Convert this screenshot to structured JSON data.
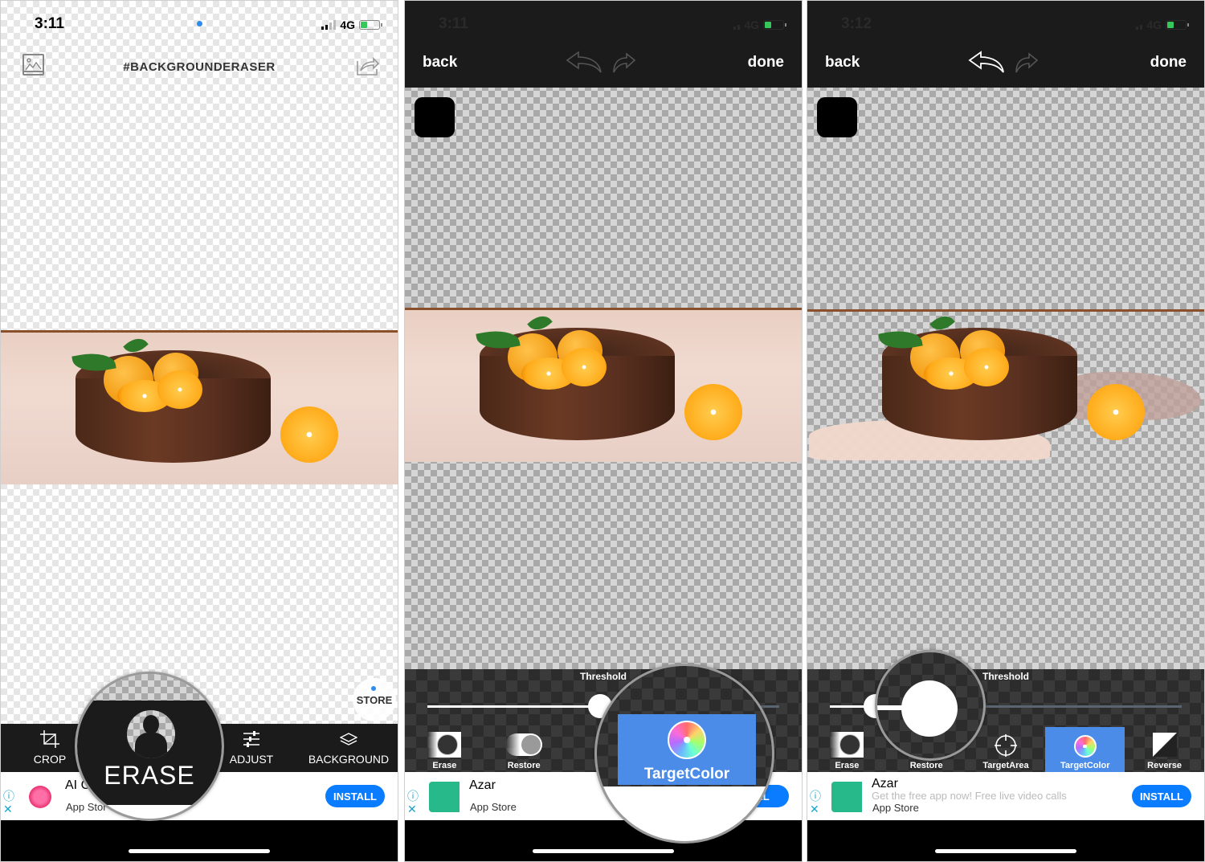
{
  "panels": [
    {
      "status": {
        "time": "3:11",
        "network": "4G"
      },
      "header": {
        "title": "#BACKGROUNDERASER"
      },
      "store_label": "STORE",
      "toolbar": [
        {
          "label": "CROP",
          "icon": "crop-icon"
        },
        {
          "label": "ERASE",
          "icon": "erase-person-icon"
        },
        {
          "label": "ADJUST",
          "icon": "sliders-icon"
        },
        {
          "label": "BACKGROUND",
          "icon": "layers-icon"
        }
      ],
      "magnified_label": "ERASE",
      "ad": {
        "title": "AI C",
        "source": "App Stor",
        "install": "INSTALL"
      }
    },
    {
      "status": {
        "time": "3:11",
        "network": "4G"
      },
      "nav": {
        "back": "back",
        "done": "done"
      },
      "threshold_label": "Threshold",
      "threshold_value": 0.49,
      "modes": [
        {
          "label": "Erase"
        },
        {
          "label": "Restore"
        },
        {
          "label": "Tar"
        },
        {
          "label": "TargetColor",
          "active": true
        },
        {
          "label": "e"
        }
      ],
      "magnified_label": "TargetColor",
      "ad": {
        "title": "Azar",
        "source": "App Store",
        "install": "ALL"
      }
    },
    {
      "status": {
        "time": "3:12",
        "network": "4G"
      },
      "nav": {
        "back": "back",
        "done": "done"
      },
      "threshold_label": "Threshold",
      "threshold_value": 0.13,
      "modes": [
        {
          "label": "Erase"
        },
        {
          "label": "Restore"
        },
        {
          "label": "TargetArea"
        },
        {
          "label": "TargetColor",
          "active": true
        },
        {
          "label": "Reverse"
        }
      ],
      "ad": {
        "title": "Azar",
        "subtitle": "Get the free app now! Free live video calls",
        "source": "App Store",
        "install": "INSTALL"
      }
    }
  ],
  "colors": {
    "accent_blue": "#4a8ce8",
    "install_blue": "#0a7cff",
    "dark_bar": "#1b1b1b"
  }
}
